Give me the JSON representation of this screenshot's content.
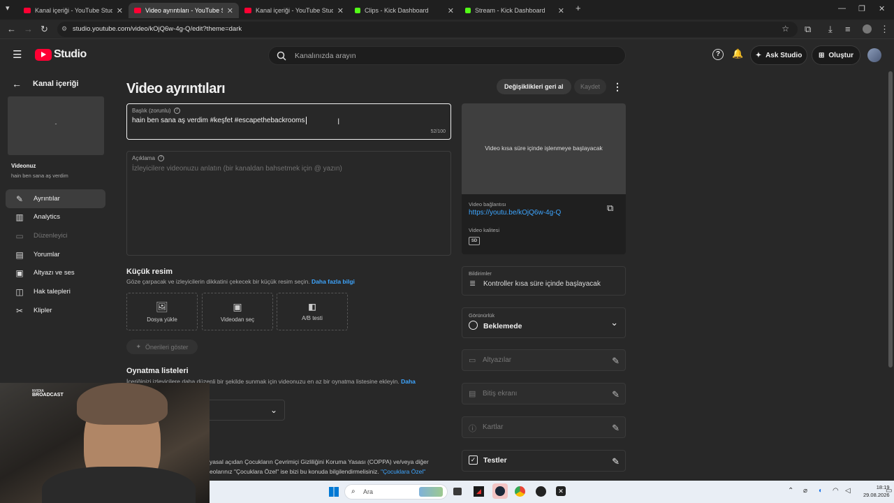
{
  "browser": {
    "tabs": [
      {
        "label": "Kanal içeriği - YouTube Studio",
        "active": false,
        "favicon_color": "#ff0033"
      },
      {
        "label": "Video ayrıntıları - YouTube Studio",
        "active": true,
        "favicon_color": "#ff0033"
      },
      {
        "label": "Kanal içeriği - YouTube Studio",
        "active": false,
        "favicon_color": "#ff0033"
      },
      {
        "label": "Clips - Kick Dashboard",
        "active": false,
        "favicon_color": "#53fc18"
      },
      {
        "label": "Stream - Kick Dashboard",
        "active": false,
        "favicon_color": "#53fc18"
      }
    ],
    "url": "studio.youtube.com/video/kOjQ6w-4g-Q/edit?theme=dark"
  },
  "header": {
    "logo_text": "Studio",
    "search_placeholder": "Kanalınızda arayın",
    "ask_studio": "Ask Studio",
    "create": "Oluştur"
  },
  "sidebar": {
    "back_label": "Kanal içeriği",
    "thumb_mark": "-",
    "your_video_label": "Videonuz",
    "video_title": "hain ben sana aş verdim",
    "items": [
      {
        "label": "Ayrıntılar",
        "icon": "pencil-icon",
        "glyph": "✎",
        "selected": true,
        "disabled": false
      },
      {
        "label": "Analytics",
        "icon": "analytics-icon",
        "glyph": "▥",
        "selected": false,
        "disabled": false
      },
      {
        "label": "Düzenleyici",
        "icon": "editor-icon",
        "glyph": "▭",
        "selected": false,
        "disabled": true
      },
      {
        "label": "Yorumlar",
        "icon": "comments-icon",
        "glyph": "▤",
        "selected": false,
        "disabled": false
      },
      {
        "label": "Altyazı ve ses",
        "icon": "subtitles-icon",
        "glyph": "▣",
        "selected": false,
        "disabled": false
      },
      {
        "label": "Hak talepleri",
        "icon": "claims-icon",
        "glyph": "◫",
        "selected": false,
        "disabled": false
      },
      {
        "label": "Klipler",
        "icon": "scissors-icon",
        "glyph": "✂",
        "selected": false,
        "disabled": false
      }
    ]
  },
  "main": {
    "page_title": "Video ayrıntıları",
    "undo_button": "Değişiklikleri geri al",
    "save_button": "Kaydet",
    "title_field": {
      "label": "Başlık (zorunlu)",
      "value": "hain ben sana aş verdim #keşfet #escapethebackrooms",
      "counter": "52/100"
    },
    "description_field": {
      "label": "Açıklama",
      "placeholder": "İzleyicilere videonuzu anlatın (bir kanaldan bahsetmek için @ yazın)"
    },
    "thumbnail": {
      "heading": "Küçük resim",
      "desc": "Göze çarpacak ve izleyicilerin dikkatini çekecek bir küçük resim seçin.",
      "link": "Daha fazla bilgi",
      "buttons": [
        "Dosya yükle",
        "Videodan seç",
        "A/B testi"
      ],
      "suggestions": "Önerileri göster"
    },
    "playlists": {
      "heading": "Oynatma listeleri",
      "desc": "İçeriğinizi izleyicilere daha düzenli bir şekilde sunmak için videonuzu en az bir oynatma listesine ekleyin.",
      "link": "Daha"
    },
    "coppa": {
      "line1": "yasal açıdan Çocukların Çevrimiçi Gizliliğini Koruma Yasası (COPPA) ve/veya diğer",
      "line2": "eolarınız \"Çocuklara Özel\" ise bizi bu konuda bilgilendirmelisiniz.",
      "link": "\"Çocuklara Özel\""
    }
  },
  "right": {
    "preview_text": "Video kısa süre içinde işlenmeye başlayacak",
    "link_label": "Video bağlantısı",
    "link_url": "https://youtu.be/kOjQ6w-4g-Q",
    "quality_label": "Video kalitesi",
    "quality_badge": "SD",
    "notifications_label": "Bildirimler",
    "notifications_value": "Kontroller kısa süre içinde başlayacak",
    "visibility_label": "Görünürlük",
    "visibility_value": "Beklemede",
    "subtitles": "Altyazılar",
    "end_screen": "Bitiş ekranı",
    "cards": "Kartlar",
    "tests": "Testler"
  },
  "overlay": {
    "broadcast_line1": "NVIDIA",
    "broadcast_line2": "BROADCAST"
  },
  "taskbar": {
    "search": "Ara",
    "time": "18:19",
    "date": "29.08.2026"
  }
}
